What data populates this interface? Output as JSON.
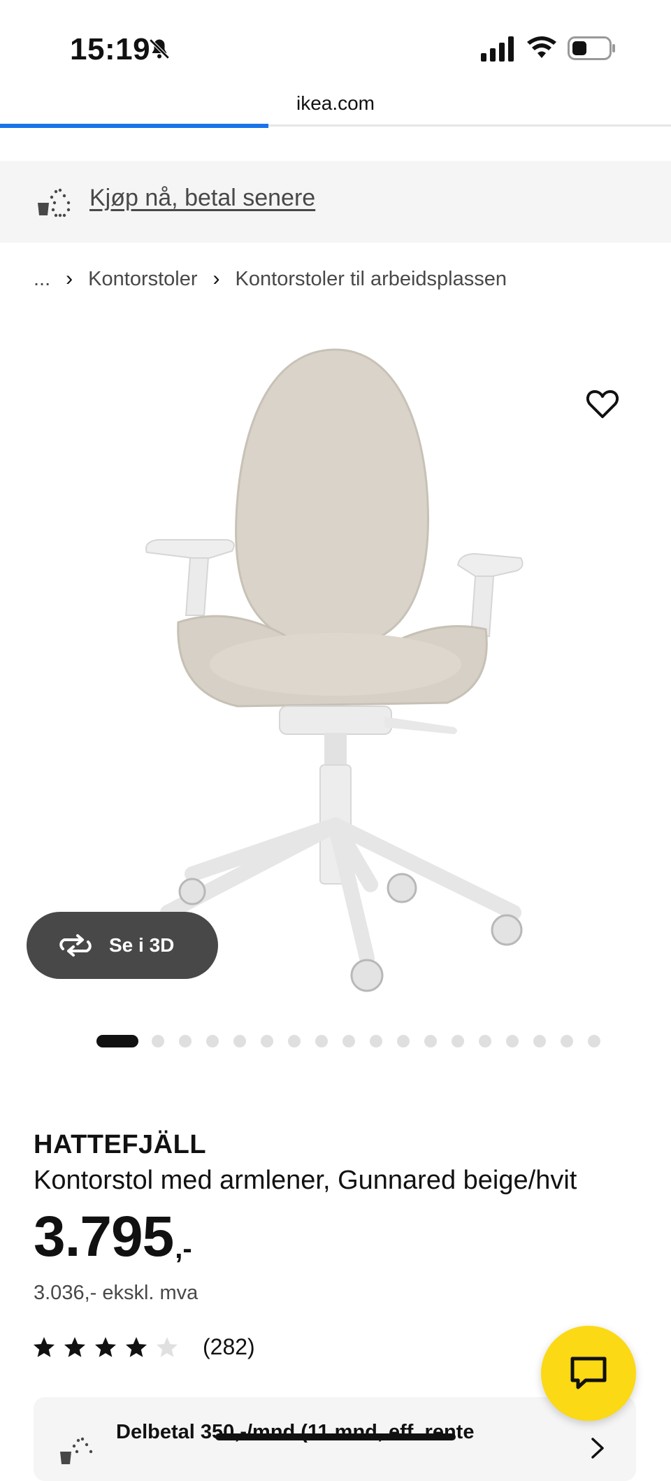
{
  "status_bar": {
    "time": "15:19",
    "icons": [
      "bell-muted-icon",
      "cellular-signal-icon",
      "wifi-icon",
      "battery-icon"
    ]
  },
  "browser": {
    "domain": "ikea.com",
    "load_progress": 0.4,
    "progress_color": "#1a73e8"
  },
  "banner": {
    "icon": "scale-icon",
    "link_text": "Kjøp nå, betal senere"
  },
  "breadcrumb": {
    "ellipsis": "...",
    "separator": "›",
    "items": [
      "Kontorstoler",
      "Kontorstoler til arbeidsplassen"
    ]
  },
  "product": {
    "image_icon": "office-chair-image",
    "favourite_icon": "heart-icon",
    "view_3d_label": "Se i 3D",
    "view_3d_icon": "rotate-3d-icon",
    "carousel": {
      "count": 18,
      "active_index": 0
    },
    "brand": "HATTEFJÄLL",
    "description": "Kontorstol med armlener, Gunnared beige/hvit",
    "price_main": "3.795",
    "price_suffix": ",-",
    "price_ex_vat": "3.036,- ekskl. mva",
    "rating": {
      "value": 4,
      "max": 5,
      "count": "(282)"
    }
  },
  "chat": {
    "icon": "chat-bubble-icon",
    "color": "#fbd914"
  },
  "installment": {
    "icon": "scale-icon",
    "text": "Delbetal 350,-/mnd (11 mnd, eff. rente",
    "chevron": "chevron-right-icon"
  },
  "colors": {
    "accent_yellow": "#fbd914",
    "text_dark": "#111111",
    "text_muted": "#484848"
  }
}
